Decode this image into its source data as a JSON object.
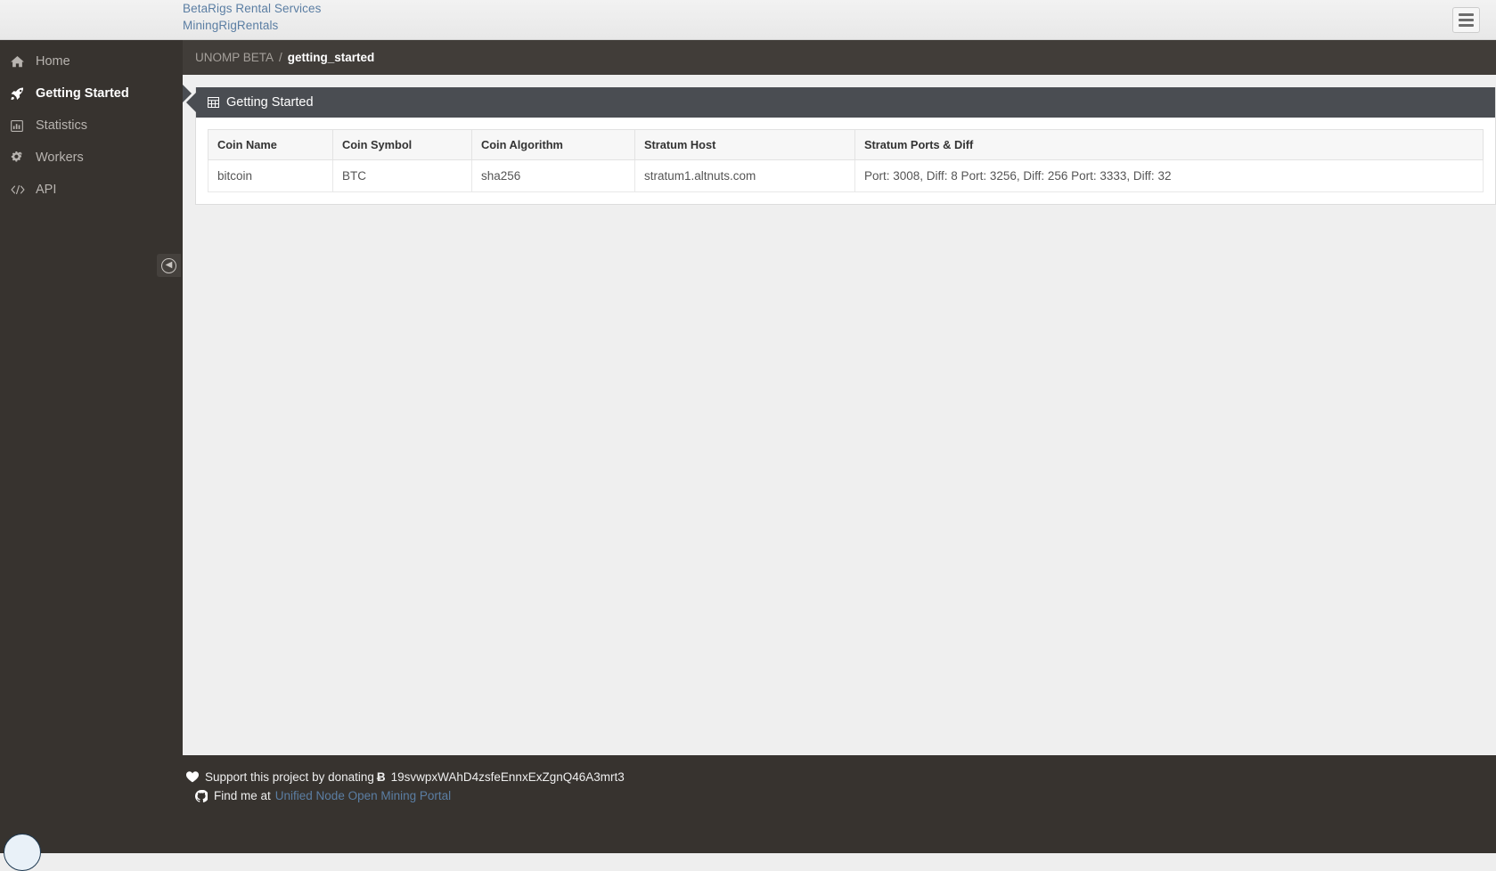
{
  "header": {
    "links": [
      {
        "label": "BetaRigs Rental Services"
      },
      {
        "label": "MiningRigRentals"
      }
    ],
    "menu_icon": "hamburger-icon"
  },
  "sidebar": {
    "items": [
      {
        "label": "Home",
        "icon": "home-icon",
        "active": false
      },
      {
        "label": "Getting Started",
        "icon": "rocket-icon",
        "active": true
      },
      {
        "label": "Statistics",
        "icon": "bar-chart-icon",
        "active": false
      },
      {
        "label": "Workers",
        "icon": "gears-icon",
        "active": false
      },
      {
        "label": "API",
        "icon": "code-icon",
        "active": false
      }
    ],
    "collapse_icon": "arrow-circle-left-icon"
  },
  "breadcrumb": {
    "root": "UNOMP BETA",
    "separator": "/",
    "current": "getting_started"
  },
  "panel": {
    "title": "Getting Started",
    "icon": "table-grid-icon"
  },
  "table": {
    "columns": [
      "Coin Name",
      "Coin Symbol",
      "Coin Algorithm",
      "Stratum Host",
      "Stratum Ports & Diff"
    ],
    "rows": [
      {
        "coin_name": "bitcoin",
        "coin_symbol": "BTC",
        "coin_algorithm": "sha256",
        "stratum_host": "stratum1.altnuts.com",
        "stratum_ports": "Port: 3008, Diff: 8 Port: 3256, Diff: 256 Port: 3333, Diff: 32"
      }
    ]
  },
  "footer": {
    "donate_icon": "heart-icon",
    "donate_text": "Support this project by donating",
    "btc_symbol": "Ƀ",
    "btc_address": "19svwpxWAhD4zsfeEnnxExZgnQ46A3mrt3",
    "github_icon": "github-icon",
    "find_text": "Find me at",
    "find_link": "Unified Node Open Mining Portal"
  },
  "colors": {
    "sidebar_bg": "#37332f",
    "breadcrumb_bg": "#413d39",
    "panel_heading_bg": "#4a4d52",
    "link_blue": "#5b7ea3",
    "content_bg": "#efefef"
  }
}
